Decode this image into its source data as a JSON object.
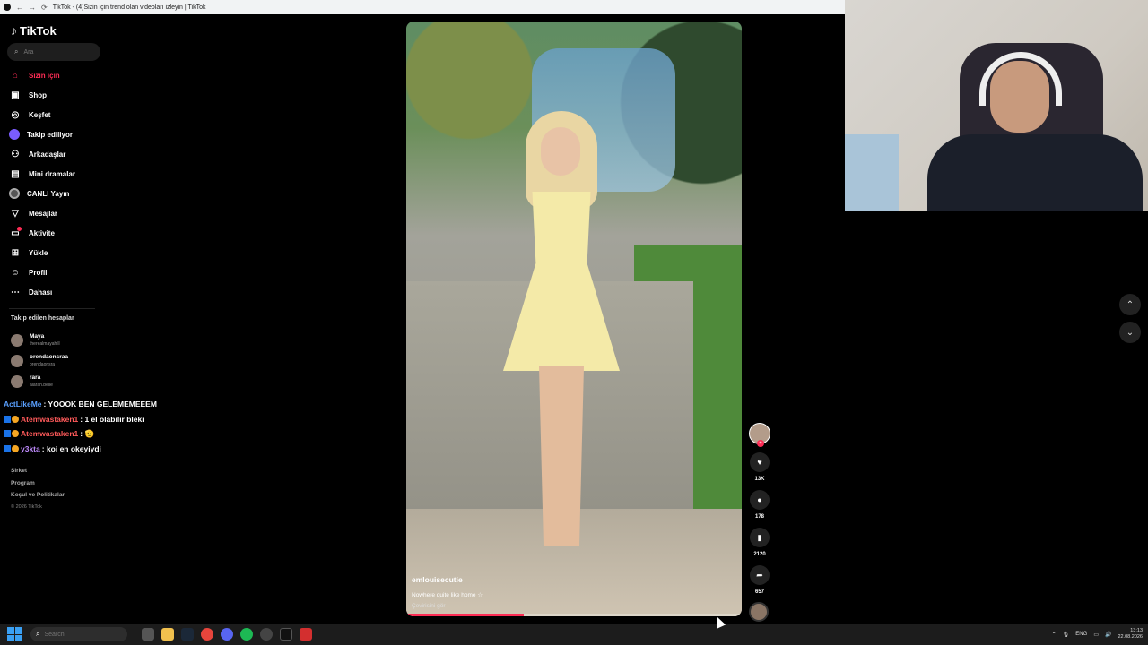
{
  "browser": {
    "tab_title": "TikTok - (4)Sizin için trend olan videoları izleyin | TikTok"
  },
  "sidebar": {
    "logo_text": "TikTok",
    "search_placeholder": "Ara",
    "items": [
      {
        "label": "Sizin için",
        "icon": "home-icon",
        "active": true
      },
      {
        "label": "Shop",
        "icon": "shop-icon"
      },
      {
        "label": "Keşfet",
        "icon": "compass-icon"
      },
      {
        "label": "Takip ediliyor",
        "icon": "following-icon"
      },
      {
        "label": "Arkadaşlar",
        "icon": "friends-icon"
      },
      {
        "label": "Mini dramalar",
        "icon": "drama-icon"
      },
      {
        "label": "CANLI Yayın",
        "icon": "live-icon"
      },
      {
        "label": "Mesajlar",
        "icon": "messages-icon"
      },
      {
        "label": "Aktivite",
        "icon": "activity-icon"
      },
      {
        "label": "Yükle",
        "icon": "upload-icon"
      },
      {
        "label": "Profil",
        "icon": "profile-icon"
      },
      {
        "label": "Dahası",
        "icon": "more-icon"
      }
    ],
    "followed_title": "Takip edilen hesaplar",
    "followed_accounts": [
      {
        "name": "Maya",
        "handle": "therealmayahill"
      },
      {
        "name": "orendaonsraa",
        "handle": "orendaonsra"
      },
      {
        "name": "rara",
        "handle": "alarah.belle"
      }
    ],
    "footer": {
      "links": [
        "Şirket",
        "Program",
        "Koşul ve Politikalar"
      ],
      "copyright": "© 2026 TikTok"
    }
  },
  "chat": [
    {
      "user": "ActLikeMe",
      "user_color": "#5aa0ff",
      "text": ": YOOOK BEN GELEMEMEEEM"
    },
    {
      "user": "Atemwastaken1",
      "user_color": "#ff5a5a",
      "text": ": 1 el olabilir bleki"
    },
    {
      "user": "Atemwastaken1",
      "user_color": "#ff5a5a",
      "text": ": 🫡"
    },
    {
      "user": "y3kta",
      "user_color": "#c08cff",
      "text": ": koi en okeyiydi"
    }
  ],
  "video": {
    "creator": "emlouisecutie",
    "caption": "Nowhere quite like home ☆",
    "translate": "Çevirisini gör",
    "progress_percent": 35
  },
  "actions": [
    {
      "icon": "heart-icon",
      "glyph": "♥",
      "count": "13K"
    },
    {
      "icon": "comment-icon",
      "glyph": "●",
      "count": "178"
    },
    {
      "icon": "bookmark-icon",
      "glyph": "▮",
      "count": "2120"
    },
    {
      "icon": "share-icon",
      "glyph": "➦",
      "count": "657"
    }
  ],
  "taskbar": {
    "search_placeholder": "Search",
    "language": "ENG",
    "time": "13:13",
    "date": "22.08.2026"
  }
}
